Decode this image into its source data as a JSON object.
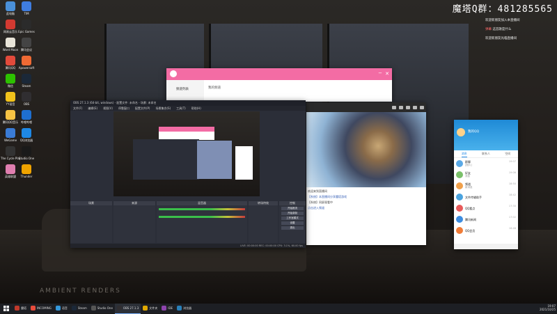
{
  "watermark": "魔塔Q群：481285565",
  "desktop_brand": "AMBIENT RENDERS",
  "desktop_icons": [
    {
      "label": "此电脑",
      "color": "#4a90d9"
    },
    {
      "label": "网易云音乐",
      "color": "#d33a31"
    },
    {
      "label": "Word Moon",
      "color": "#e8e4d8"
    },
    {
      "label": "腾讯QQ",
      "color": "#e24a3b"
    },
    {
      "label": "微信",
      "color": "#2dc100"
    },
    {
      "label": "YY语音",
      "color": "#f1c21b"
    },
    {
      "label": "腾讯QQ音乐",
      "color": "#f6c344"
    },
    {
      "label": "WeGame",
      "color": "#3a7bd5"
    },
    {
      "label": "The Cycle Playtest",
      "color": "#333333"
    },
    {
      "label": "英雄联盟",
      "color": "#e07fb0"
    },
    {
      "label": "TIM",
      "color": "#3f7de0"
    },
    {
      "label": "Epic Games",
      "color": "#2b2b2b"
    },
    {
      "label": "腾讯会议",
      "color": "#444444"
    },
    {
      "label": "Apowersoft",
      "color": "#ef6a34"
    },
    {
      "label": "Steam",
      "color": "#1b2838"
    },
    {
      "label": "OBS",
      "color": "#302e31"
    },
    {
      "label": "哔哩哔哩",
      "color": "#1e6fd0"
    },
    {
      "label": "QQ浏览器",
      "color": "#1e88e5"
    },
    {
      "label": "Studio One",
      "color": "#1a1a1a"
    },
    {
      "label": "Thunder",
      "color": "#f0a400"
    }
  ],
  "chat_panel": [
    {
      "name": "欢迎新朋友加入本直播间",
      "text": "",
      "red": false
    },
    {
      "name": "弹幕",
      "text": "这首歌是什么",
      "red": true
    },
    {
      "name": "",
      "text": "欢迎新朋友光临直播间",
      "red": false
    },
    {
      "name": "",
      "text": "",
      "red": false
    }
  ],
  "pink_window": {
    "sidebar_label": "频道列表",
    "content": "我的频道"
  },
  "obs": {
    "title": "OBS 27.1.3 (64-bit, windows) - 配置文件: 未命名 - 场景: 未命名",
    "menu": [
      "文件(F)",
      "编辑(E)",
      "视图(V)",
      "停靠窗口",
      "配置文件(P)",
      "场景集合(S)",
      "工具(T)",
      "帮助(H)"
    ],
    "docks": [
      "场景",
      "来源",
      "混音器",
      "转场特效",
      "控制"
    ],
    "controls": [
      "开始推流",
      "开始录制",
      "工作室模式",
      "设置",
      "退出"
    ],
    "status": "LIVE: 00:00:00  REC: 00:00:00  CPU: 3.1%, 60.00 fps"
  },
  "game_messages": [
    {
      "text": "欢迎来到直播间",
      "blue": false
    },
    {
      "text": "【系统】本直播间分享魔塔游戏",
      "blue": true
    },
    {
      "text": "【系统】同屏观看中",
      "blue": false
    },
    {
      "text": "点击进入频道",
      "blue": true
    }
  ],
  "qq": {
    "name": "我的QQ",
    "tabs": [
      "消息",
      "联系人",
      "空间"
    ],
    "items": [
      {
        "name": "群聊",
        "sub": "[图片]",
        "time": "19:07",
        "color": "#5aa9e6"
      },
      {
        "name": "好友",
        "sub": "消息",
        "time": "19:06",
        "color": "#7ac06a"
      },
      {
        "name": "频道",
        "sub": "新消息",
        "time": "18:50",
        "color": "#f0a04b"
      },
      {
        "name": "文件传输助手",
        "sub": "",
        "time": "18:42",
        "color": "#4aa3df"
      },
      {
        "name": "QQ看点",
        "sub": "",
        "time": "17:30",
        "color": "#e85a5a"
      },
      {
        "name": "腾讯新闻",
        "sub": "",
        "time": "17:02",
        "color": "#3d8de0"
      },
      {
        "name": "QQ会员",
        "sub": "",
        "time": "16:48",
        "color": "#f07c38"
      }
    ]
  },
  "taskbar": {
    "items": [
      {
        "label": "魔塔",
        "color": "#c0392b"
      },
      {
        "label": "INCOMING",
        "color": "#e74c3c"
      },
      {
        "label": "语音",
        "color": "#3498db"
      },
      {
        "label": "Steam",
        "color": "#1b2838"
      },
      {
        "label": "Studio One",
        "color": "#555555"
      },
      {
        "label": "OBS 27.1.3",
        "color": "#302e31"
      },
      {
        "label": "文件夹",
        "color": "#e0a800"
      },
      {
        "label": "IDE",
        "color": "#8e44ad"
      },
      {
        "label": "浏览器",
        "color": "#2980b9"
      }
    ],
    "time": "19:07",
    "date": "2021/10/25"
  }
}
